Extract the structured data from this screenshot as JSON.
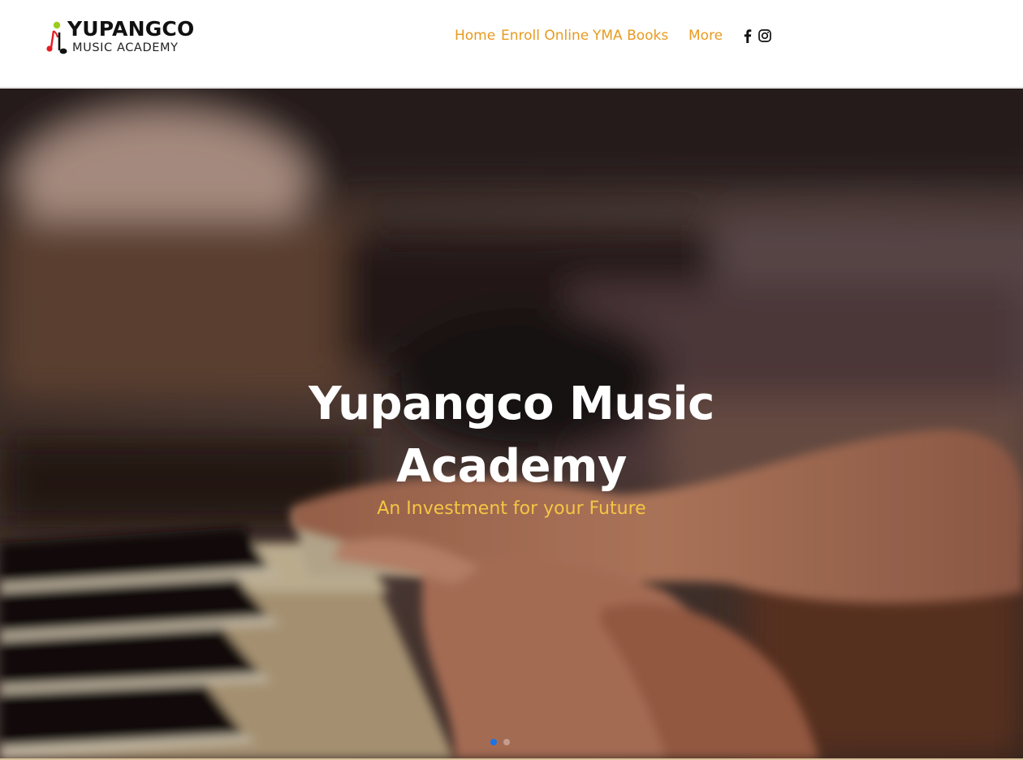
{
  "logo": {
    "line1": "YUPANGCO",
    "line2": "MUSIC ACADEMY"
  },
  "nav": {
    "items": [
      {
        "label": "Home"
      },
      {
        "label": "Enroll Online"
      },
      {
        "label": "YMA Books"
      },
      {
        "label": "More"
      }
    ]
  },
  "social": {
    "icons": [
      "facebook-icon",
      "instagram-icon"
    ]
  },
  "hero": {
    "title": "Yupangco Music Academy",
    "subtitle": "An Investment for your Future",
    "slides_total": 2,
    "active_slide": 1
  },
  "colors": {
    "nav_accent": "#e89a1f",
    "subtitle": "#f6c543",
    "active_dot": "#1a73e8"
  }
}
